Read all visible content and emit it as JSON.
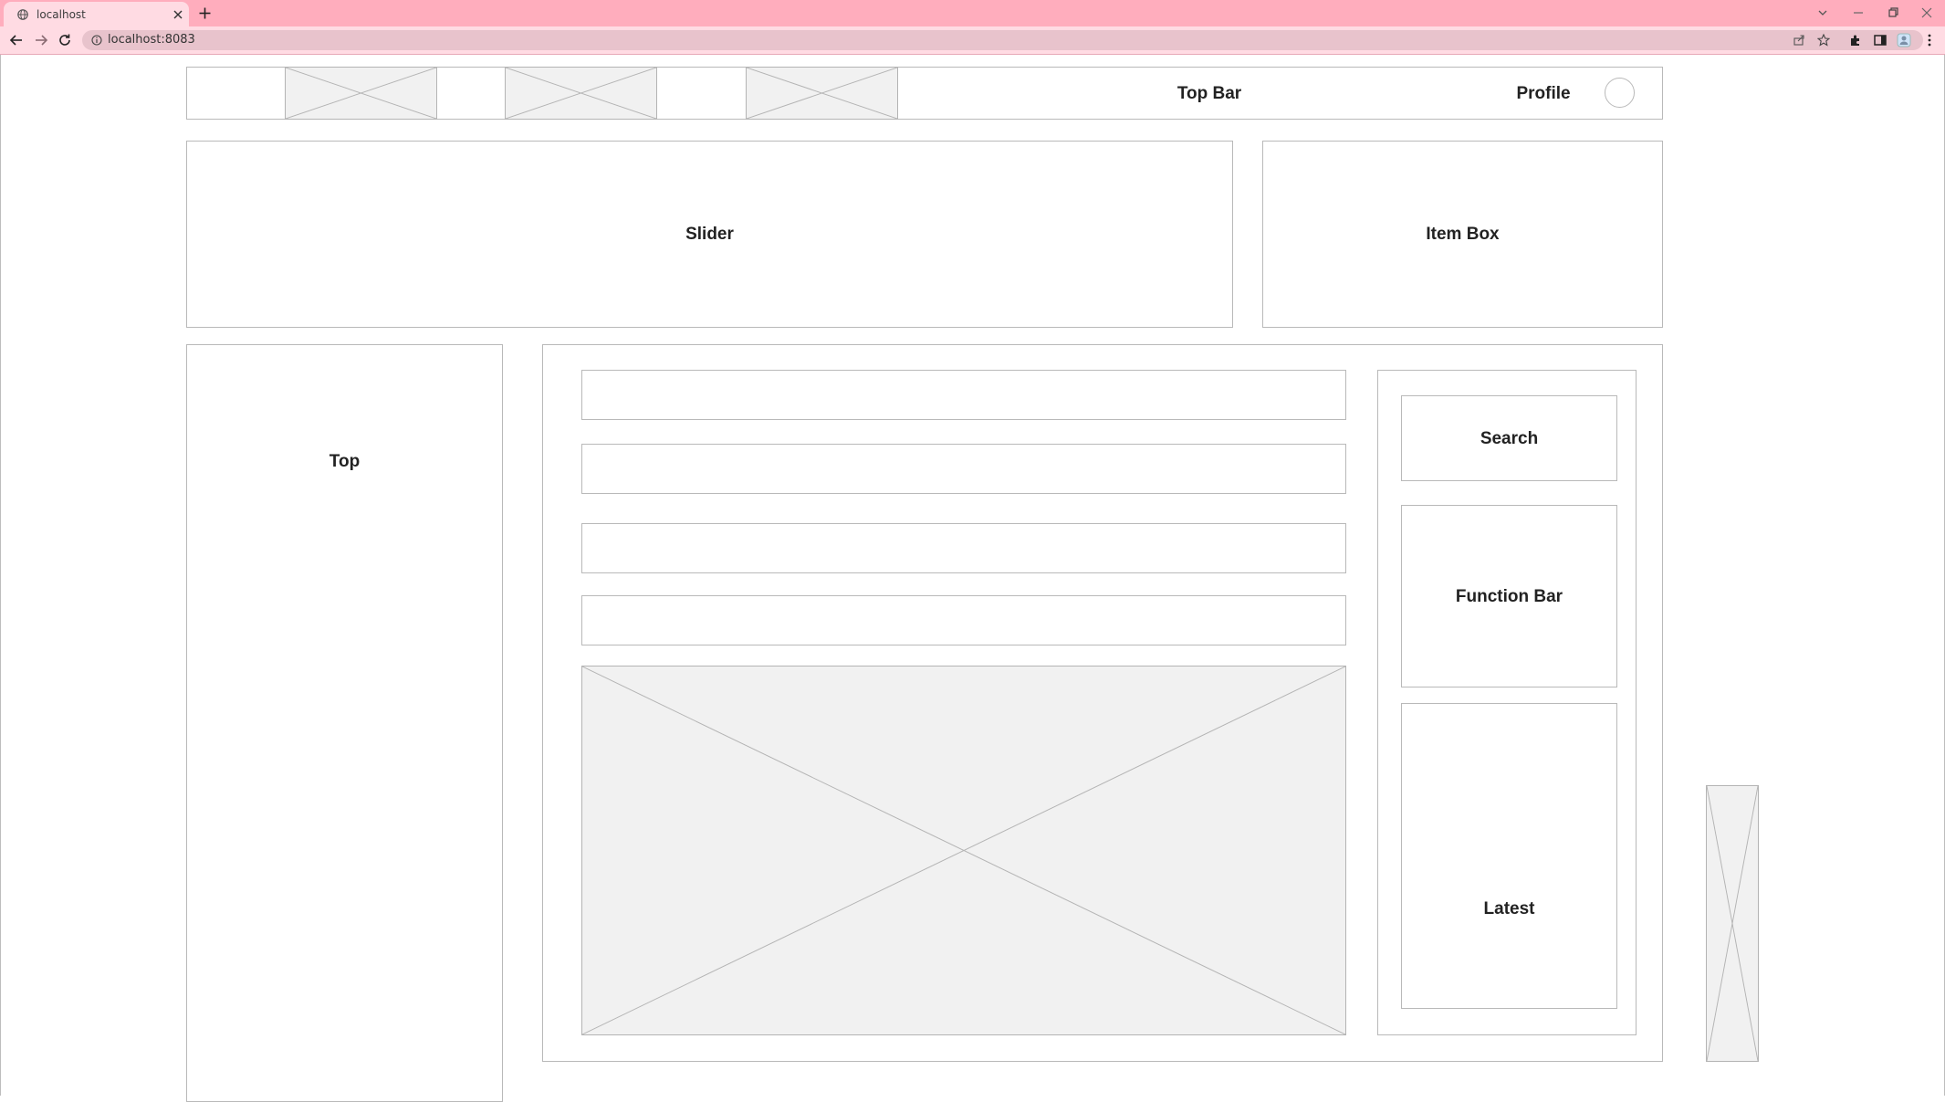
{
  "browser": {
    "tab_title": "localhost",
    "url": "localhost:8083",
    "colors": {
      "tabstrip": "#ffadbd",
      "toolbar": "#ffdbe3",
      "omnibox": "#e8c3cc"
    },
    "icons": [
      "globe-icon",
      "close-icon",
      "plus-icon",
      "back-icon",
      "forward-icon",
      "reload-icon",
      "info-icon",
      "share-icon",
      "star-icon",
      "extensions-icon",
      "sidepanel-icon",
      "profile-icon",
      "menu-icon",
      "minimize-icon",
      "maximize-icon",
      "window-close-icon",
      "tab-search-icon"
    ]
  },
  "wireframe": {
    "top_bar": {
      "label": "Top Bar",
      "profile_label": "Profile"
    },
    "slider": {
      "label": "Slider"
    },
    "item_box": {
      "label": "Item Box"
    },
    "left_column": {
      "label": "Top"
    },
    "sidebar": {
      "search_label": "Search",
      "function_bar_label": "Function Bar",
      "latest_label": "Latest"
    }
  }
}
